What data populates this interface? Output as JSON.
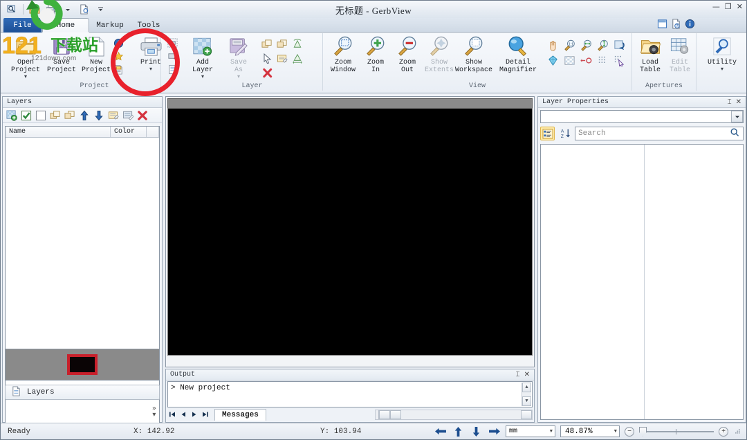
{
  "window": {
    "title": "无标题 - GerbView",
    "minimize_label": "—",
    "maximize_label": "❐",
    "close_label": "✕"
  },
  "quick_access": {
    "items": [
      {
        "name": "zoom-find-icon",
        "tooltip": "Find"
      },
      {
        "name": "open-folder-icon",
        "tooltip": "Open"
      },
      {
        "name": "print-icon",
        "tooltip": "Print"
      },
      {
        "name": "print-dropdown-caret",
        "tooltip": "Print options"
      },
      {
        "name": "print-preview-icon",
        "tooltip": "Print Preview"
      },
      {
        "name": "customize-caret",
        "tooltip": "Customize Quick Access Toolbar"
      }
    ]
  },
  "title_right_icons": [
    {
      "name": "window-layout-icon"
    },
    {
      "name": "help-page-icon"
    },
    {
      "name": "about-info-icon"
    }
  ],
  "tabs": [
    {
      "id": "file",
      "label": "File",
      "active": false
    },
    {
      "id": "home",
      "label": "Home",
      "active": true
    },
    {
      "id": "markup",
      "label": "Markup",
      "active": false
    },
    {
      "id": "tools",
      "label": "Tools",
      "active": false
    }
  ],
  "ribbon": {
    "groups": [
      {
        "id": "project",
        "label": "Project",
        "buttons": [
          {
            "label": "Open\nProject",
            "icon": "open-folder-icon",
            "dropdown": true,
            "disabled": false
          },
          {
            "label": "Save\nProject",
            "icon": "save-disk-icon",
            "dropdown": false,
            "disabled": false
          },
          {
            "label": "New\nProject",
            "icon": "new-page-icon",
            "dropdown": false,
            "disabled": false
          },
          {
            "label": "Print",
            "icon": "printer-icon",
            "dropdown": true,
            "disabled": false
          }
        ],
        "small_icons_left": [
          "project-info-icon",
          "project-star-icon",
          "project-properties-icon"
        ],
        "small_icons_right": [
          "print-preview-icon",
          "print-setup-icon",
          "page-setup-icon"
        ]
      },
      {
        "id": "layer",
        "label": "Layer",
        "buttons": [
          {
            "label": "Add\nLayer",
            "icon": "add-layer-icon",
            "dropdown": true,
            "disabled": false
          },
          {
            "label": "Save\nAs",
            "icon": "save-as-layer-icon",
            "dropdown": true,
            "disabled": true
          }
        ],
        "mini_icons": [
          "layer-move-front-icon",
          "layer-move-back-icon",
          "flip-vertical-icon",
          "select-arrow-icon",
          "layer-properties-icon",
          "delete-layer-icon",
          "mirror-horizontal-icon"
        ]
      },
      {
        "id": "view",
        "label": "View",
        "buttons": [
          {
            "label": "Zoom\nWindow",
            "icon": "zoom-window-icon",
            "dropdown": false,
            "disabled": false
          },
          {
            "label": "Zoom\nIn",
            "icon": "zoom-in-icon",
            "dropdown": false,
            "disabled": false
          },
          {
            "label": "Zoom\nOut",
            "icon": "zoom-out-icon",
            "dropdown": false,
            "disabled": false
          },
          {
            "label": "Show\nExtents",
            "icon": "show-extents-icon",
            "dropdown": false,
            "disabled": true
          },
          {
            "label": "Show\nWorkspace",
            "icon": "show-workspace-icon",
            "dropdown": false,
            "disabled": false
          },
          {
            "label": "Detail\nMagnifier",
            "icon": "detail-magnifier-icon",
            "dropdown": false,
            "disabled": false
          }
        ],
        "mini_icons": [
          "pan-hand-icon",
          "zoom-1to1-icon",
          "zoom-width-icon",
          "zoom-height-icon",
          "refresh-view-icon",
          "transparency-icon",
          "checkerboard-icon",
          "measure-icon",
          "grid-on-icon",
          "grid-snap-icon"
        ]
      },
      {
        "id": "apertures",
        "label": "Apertures",
        "buttons": [
          {
            "label": "Load\nTable",
            "icon": "load-table-icon",
            "dropdown": false,
            "disabled": false
          },
          {
            "label": "Edit\nTable",
            "icon": "edit-table-icon",
            "dropdown": false,
            "disabled": true
          }
        ]
      },
      {
        "id": "utility",
        "label": "",
        "buttons": [
          {
            "label": "Utility",
            "icon": "utility-magnifier-icon",
            "dropdown": true,
            "disabled": false
          }
        ]
      }
    ]
  },
  "layers_panel": {
    "title": "Layers",
    "toolbar_icons": [
      "add-layer-icon",
      "check-all-icon",
      "uncheck-all-icon",
      "move-front-icon",
      "move-back-icon",
      "move-up-icon",
      "move-down-icon",
      "layer-properties-icon",
      "layer-export-icon",
      "delete-layer-icon"
    ],
    "columns": [
      "Name",
      "Color"
    ],
    "rows": [],
    "preview_swatch_color": "#000000",
    "preview_border_color": "#c8202b",
    "bottom_tab_label": "Layers",
    "expand_label": "»"
  },
  "canvas": {
    "background_color": "#000000",
    "ruler_color": "#8a8a8a"
  },
  "output_panel": {
    "title": "Output",
    "pin_label": "⌶",
    "close_label": "✕",
    "lines": [
      "> New project"
    ],
    "tab_label": "Messages",
    "nav_buttons": [
      "first",
      "previous",
      "next",
      "last"
    ]
  },
  "layer_properties": {
    "title": "Layer Properties",
    "pin_label": "⌶",
    "close_label": "✕",
    "combo_value": "",
    "categorized_icon": "categorized-view-icon",
    "sort_icon": "alphabetical-sort-icon",
    "search_placeholder": "Search",
    "search_icon": "search-icon"
  },
  "status_bar": {
    "ready": "Ready",
    "x_label": "X:",
    "x_value": "142.92",
    "y_label": "Y:",
    "y_value": "103.94",
    "nav_icons": [
      "arrow-left-icon",
      "arrow-up-icon",
      "arrow-down-icon",
      "arrow-right-icon"
    ],
    "units_value": "mm",
    "zoom_value": "48.87%",
    "zoom_out_label": "−",
    "zoom_in_label": "+",
    "resize-grip": "resize-grip-icon"
  },
  "annotations": {
    "highlight_circle_color": "#e8212c",
    "highlight_target": "print-button"
  },
  "watermark": {
    "text_number": "121",
    "text_cn": "下载站",
    "text_domain": "121down.com"
  }
}
